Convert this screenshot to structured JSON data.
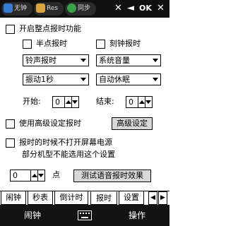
{
  "statusbar": {
    "tabs": [
      {
        "label": "无钟",
        "icon": "windows-flag-icon"
      },
      {
        "label": "Res",
        "icon": "app-icon"
      },
      {
        "label": "同步",
        "icon": "sync-icon"
      }
    ],
    "icons": [
      "signal-off-icon",
      "volume-mute-icon",
      "ok-label",
      "close-icon"
    ],
    "ok_label": "OK"
  },
  "main": {
    "enable_hourly": "开启整点报时功能",
    "half_hour": "半点报时",
    "quarter_hour": "刻钟报时",
    "sound_select": "铃声报时",
    "volume_select": "系统音量",
    "vibrate_select": "振动1秒",
    "sleep_select": "自动休眠",
    "start_label": "开始:",
    "start_value": "0",
    "end_label": "结束:",
    "end_value": "0",
    "advanced_checkbox": "使用高级设定报时",
    "advanced_button": "高级设定",
    "no_screen_line1": "报时的时候不打开屏幕电源",
    "no_screen_line2": "部分机型不能选用这个设置",
    "point_value": "0",
    "point_label": "点",
    "test_button": "测试语音报时效果"
  },
  "tabs": [
    "闹钟",
    "秒表",
    "倒计时",
    "报时",
    "设置"
  ],
  "selected_tab": "报时",
  "softkeys": {
    "left": "闹钟",
    "center_icon": "keyboard-icon",
    "right": "操作"
  },
  "colors": {
    "statusbar": "#101010",
    "softbar": "#131313",
    "button_face": "#d8d8d8"
  }
}
